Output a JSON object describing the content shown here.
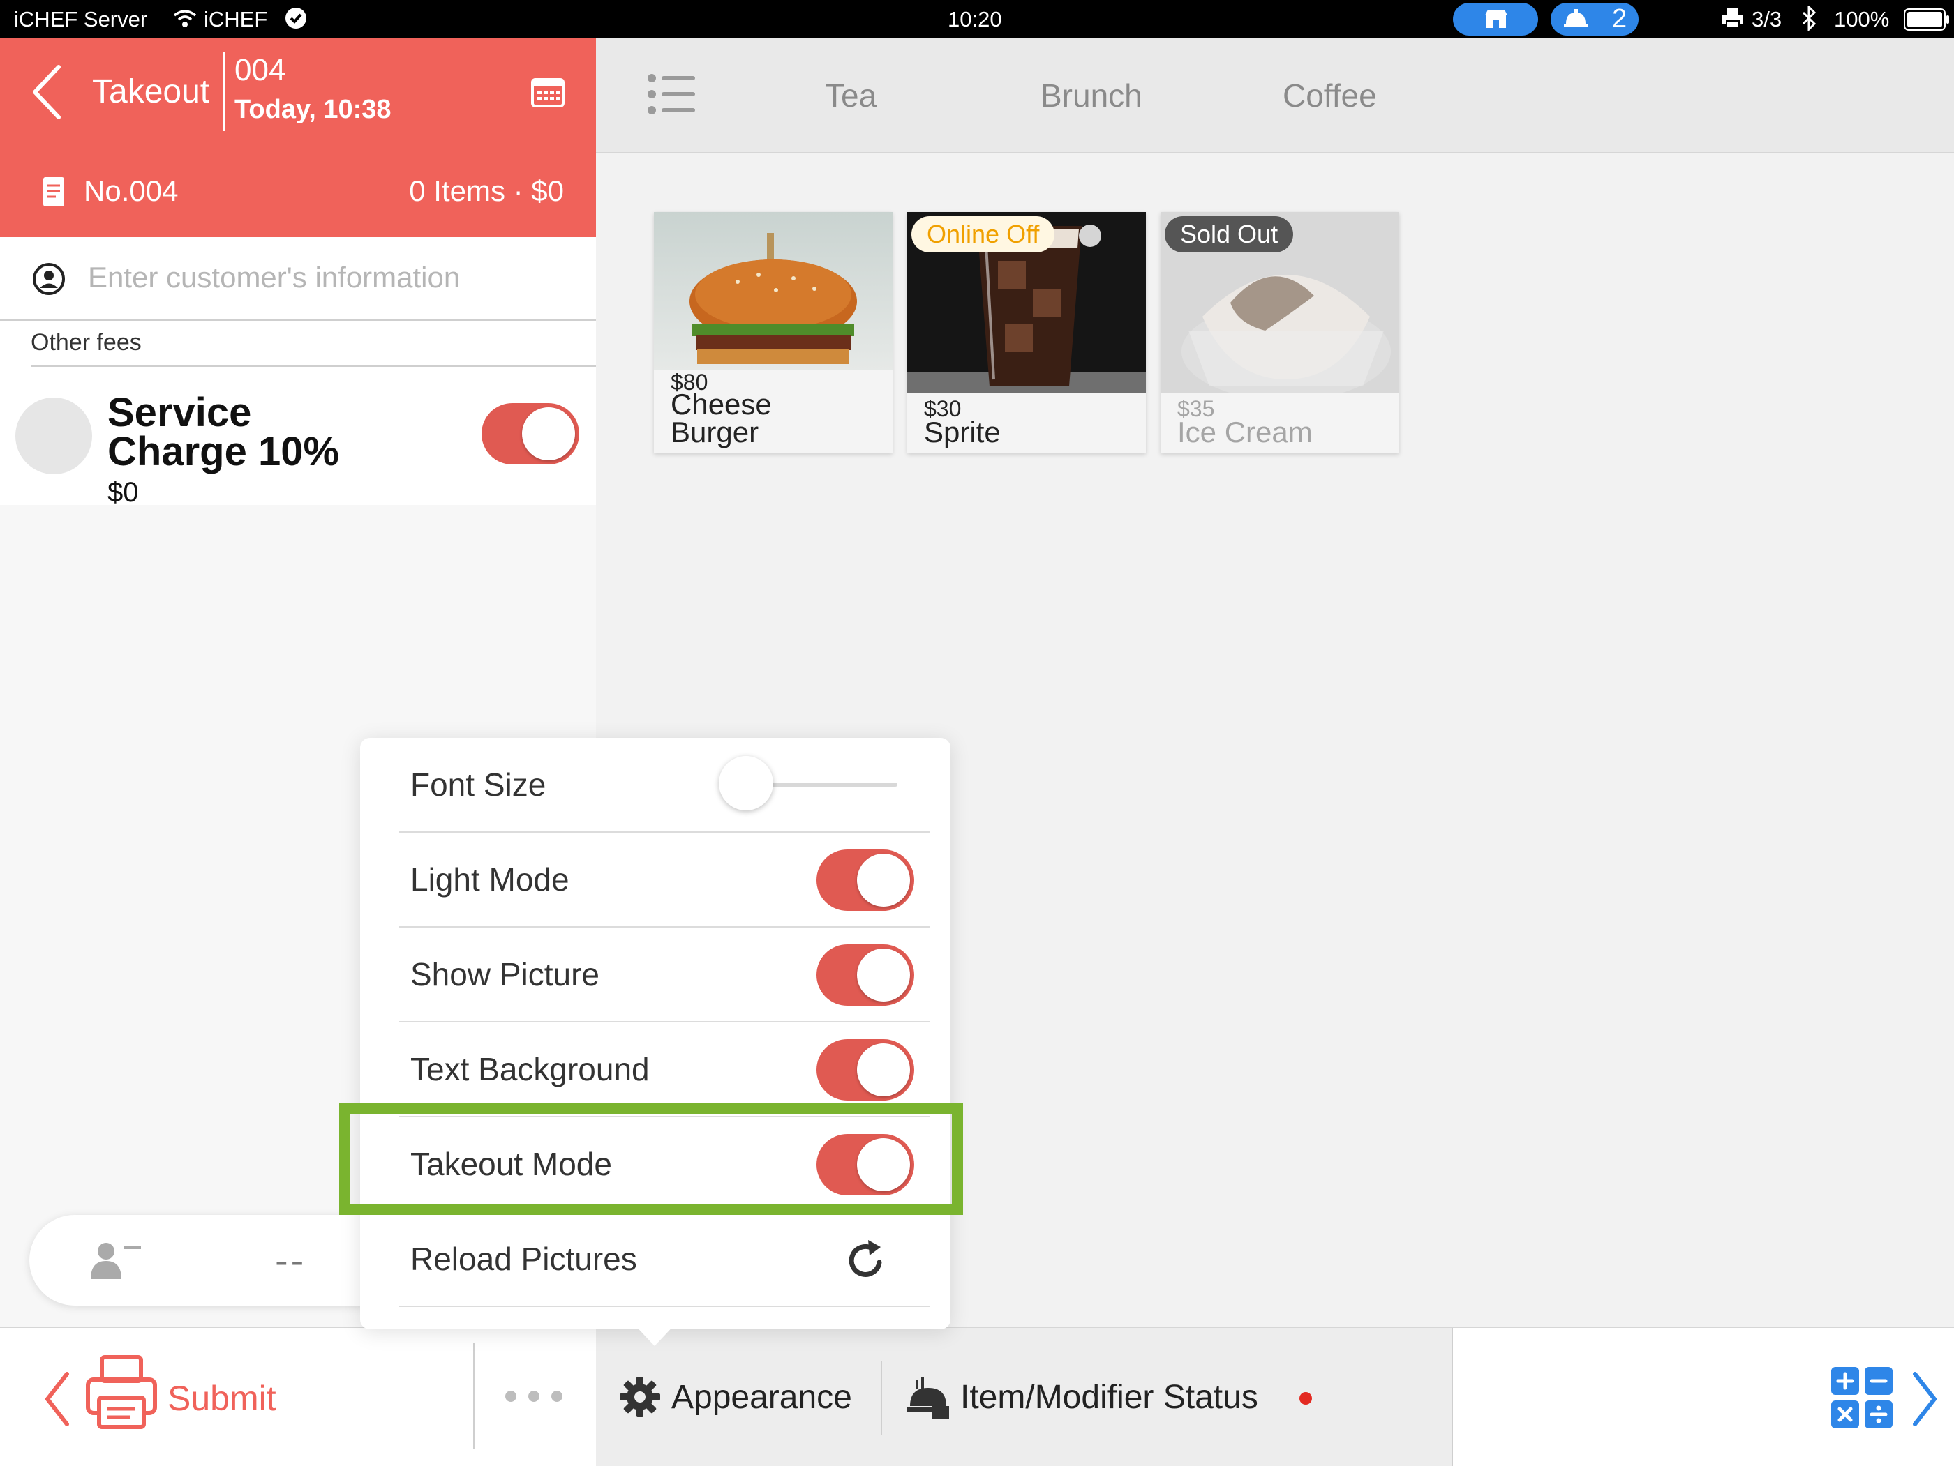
{
  "status_bar": {
    "carrier": "iCHEF Server",
    "wifi_name": "iCHEF",
    "time": "10:20",
    "bell_count": "2",
    "printer_status": "3/3",
    "battery": "100%"
  },
  "order": {
    "mode_label": "Takeout",
    "number": "004",
    "datetime": "Today, 10:38",
    "receipt_label": "No.004",
    "summary": "0 Items · $0"
  },
  "customer": {
    "placeholder": "Enter customer's information"
  },
  "fees": {
    "section_label": "Other fees",
    "items": [
      {
        "name": "Service Charge 10%",
        "amount": "$0",
        "enabled": true
      }
    ]
  },
  "guest_bar": {
    "count": "--"
  },
  "categories": {
    "tabs": [
      {
        "label": "Tea"
      },
      {
        "label": "Brunch"
      },
      {
        "label": "Coffee"
      }
    ]
  },
  "menu": {
    "items": [
      {
        "price": "$80",
        "name_line1": "Cheese",
        "name_line2": "Burger",
        "badge": ""
      },
      {
        "price": "$30",
        "name_line1": "Sprite",
        "name_line2": "",
        "badge": "Online Off"
      },
      {
        "price": "$35",
        "name_line1": "Ice Cream",
        "name_line2": "",
        "badge": "Sold Out"
      }
    ]
  },
  "appearance": {
    "font_size_label": "Font Size",
    "font_size_level": 0,
    "rows": [
      {
        "label": "Light Mode",
        "on": true
      },
      {
        "label": "Show Picture",
        "on": true
      },
      {
        "label": "Text Background",
        "on": true
      },
      {
        "label": "Takeout Mode",
        "on": true
      }
    ],
    "reload_label": "Reload Pictures"
  },
  "toolbar": {
    "submit_label": "Submit",
    "appearance_label": "Appearance",
    "status_label": "Item/Modifier Status"
  },
  "colors": {
    "accent": "#f0625a",
    "toggle_on": "#e05a52",
    "highlight": "#7ab42f",
    "ios_blue": "#2e86e8"
  }
}
